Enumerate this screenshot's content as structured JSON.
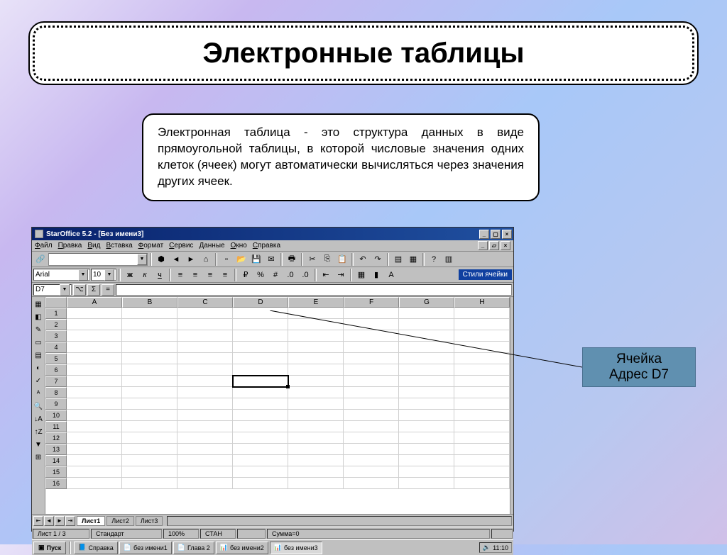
{
  "slide": {
    "title": "Электронные таблицы",
    "definition": "Электронная таблица - это структура данных в виде прямоугольной таблицы, в которой числовые значения одних клеток (ячеек) могут автоматически вычисляться через значения других ячеек."
  },
  "annotation": {
    "line1": "Ячейка",
    "line2": "Адрес D7"
  },
  "app": {
    "title": "StarOffice 5.2 - [Без имени3]",
    "menus": [
      "Файл",
      "Правка",
      "Вид",
      "Вставка",
      "Формат",
      "Сервис",
      "Данные",
      "Окно",
      "Справка"
    ],
    "font": "Arial",
    "font_size": "10",
    "style_label": "Стили ячейки",
    "cell_ref": "D7",
    "columns": [
      "A",
      "B",
      "C",
      "D",
      "E",
      "F",
      "G",
      "H"
    ],
    "row_count": 16,
    "selected_cell": {
      "col": "D",
      "row": 7
    },
    "tabs": [
      "Лист1",
      "Лист2",
      "Лист3"
    ],
    "active_tab": 0,
    "status": {
      "sheet": "Лист 1 / 3",
      "page_style": "Стандарт",
      "zoom": "100%",
      "mode": "СТАН",
      "sum": "Сумма=0"
    }
  },
  "taskbar": {
    "start": "Пуск",
    "items": [
      "Справка",
      "без имени1",
      "Глава 2",
      "без имени2",
      "без имени3"
    ],
    "active": 4,
    "time": "11:10"
  }
}
